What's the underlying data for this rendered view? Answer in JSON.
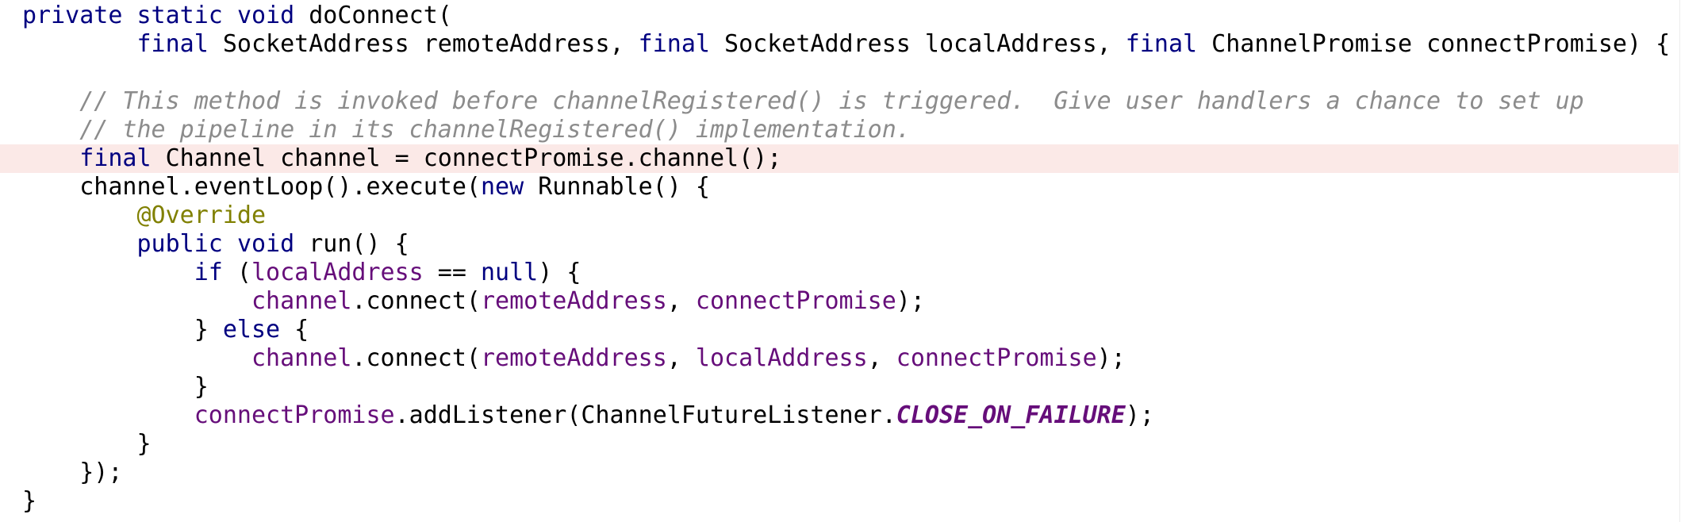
{
  "colors": {
    "keyword": "#000080",
    "comment": "#8c8c8c",
    "annotation": "#808000",
    "parameter": "#660e7a",
    "constant": "#660e7a",
    "highlight": "#fbe9e7"
  },
  "code": {
    "highlighted_line": 5,
    "lines": [
      {
        "indent": "",
        "tokens": [
          {
            "t": "private",
            "c": "kw"
          },
          {
            "t": " ",
            "c": "plain"
          },
          {
            "t": "static",
            "c": "kw"
          },
          {
            "t": " ",
            "c": "plain"
          },
          {
            "t": "void",
            "c": "kw"
          },
          {
            "t": " doConnect(",
            "c": "plain"
          }
        ]
      },
      {
        "indent": "        ",
        "tokens": [
          {
            "t": "final",
            "c": "kw"
          },
          {
            "t": " SocketAddress remoteAddress, ",
            "c": "plain"
          },
          {
            "t": "final",
            "c": "kw"
          },
          {
            "t": " SocketAddress localAddress, ",
            "c": "plain"
          },
          {
            "t": "final",
            "c": "kw"
          },
          {
            "t": " ChannelPromise connectPromise) {",
            "c": "plain"
          }
        ]
      },
      {
        "indent": "",
        "tokens": []
      },
      {
        "indent": "    ",
        "tokens": [
          {
            "t": "// This method is invoked before channelRegistered() is triggered.  Give user handlers a chance to set up",
            "c": "cmt"
          }
        ]
      },
      {
        "indent": "    ",
        "tokens": [
          {
            "t": "// the pipeline in its channelRegistered() implementation.",
            "c": "cmt"
          }
        ]
      },
      {
        "indent": "    ",
        "tokens": [
          {
            "t": "final",
            "c": "kw"
          },
          {
            "t": " Channel channel = connectPromise.channel();",
            "c": "plain"
          }
        ]
      },
      {
        "indent": "    ",
        "tokens": [
          {
            "t": "channel.eventLoop().execute(",
            "c": "plain"
          },
          {
            "t": "new",
            "c": "kw"
          },
          {
            "t": " Runnable() {",
            "c": "plain"
          }
        ]
      },
      {
        "indent": "        ",
        "tokens": [
          {
            "t": "@Override",
            "c": "ann"
          }
        ]
      },
      {
        "indent": "        ",
        "tokens": [
          {
            "t": "public",
            "c": "kw"
          },
          {
            "t": " ",
            "c": "plain"
          },
          {
            "t": "void",
            "c": "kw"
          },
          {
            "t": " run() {",
            "c": "plain"
          }
        ]
      },
      {
        "indent": "            ",
        "tokens": [
          {
            "t": "if",
            "c": "kw"
          },
          {
            "t": " (",
            "c": "plain"
          },
          {
            "t": "localAddress",
            "c": "var"
          },
          {
            "t": " == ",
            "c": "plain"
          },
          {
            "t": "null",
            "c": "kw"
          },
          {
            "t": ") {",
            "c": "plain"
          }
        ]
      },
      {
        "indent": "                ",
        "tokens": [
          {
            "t": "channel",
            "c": "var"
          },
          {
            "t": ".connect(",
            "c": "plain"
          },
          {
            "t": "remoteAddress",
            "c": "var"
          },
          {
            "t": ", ",
            "c": "plain"
          },
          {
            "t": "connectPromise",
            "c": "var"
          },
          {
            "t": ");",
            "c": "plain"
          }
        ]
      },
      {
        "indent": "            ",
        "tokens": [
          {
            "t": "} ",
            "c": "plain"
          },
          {
            "t": "else",
            "c": "kw"
          },
          {
            "t": " {",
            "c": "plain"
          }
        ]
      },
      {
        "indent": "                ",
        "tokens": [
          {
            "t": "channel",
            "c": "var"
          },
          {
            "t": ".connect(",
            "c": "plain"
          },
          {
            "t": "remoteAddress",
            "c": "var"
          },
          {
            "t": ", ",
            "c": "plain"
          },
          {
            "t": "localAddress",
            "c": "var"
          },
          {
            "t": ", ",
            "c": "plain"
          },
          {
            "t": "connectPromise",
            "c": "var"
          },
          {
            "t": ");",
            "c": "plain"
          }
        ]
      },
      {
        "indent": "            ",
        "tokens": [
          {
            "t": "}",
            "c": "plain"
          }
        ]
      },
      {
        "indent": "            ",
        "tokens": [
          {
            "t": "connectPromise",
            "c": "var"
          },
          {
            "t": ".addListener(ChannelFutureListener.",
            "c": "plain"
          },
          {
            "t": "CLOSE_ON_FAILURE",
            "c": "konst"
          },
          {
            "t": ");",
            "c": "plain"
          }
        ]
      },
      {
        "indent": "        ",
        "tokens": [
          {
            "t": "}",
            "c": "plain"
          }
        ]
      },
      {
        "indent": "    ",
        "tokens": [
          {
            "t": "});",
            "c": "plain"
          }
        ]
      },
      {
        "indent": "",
        "tokens": [
          {
            "t": "}",
            "c": "plain"
          }
        ]
      }
    ]
  }
}
